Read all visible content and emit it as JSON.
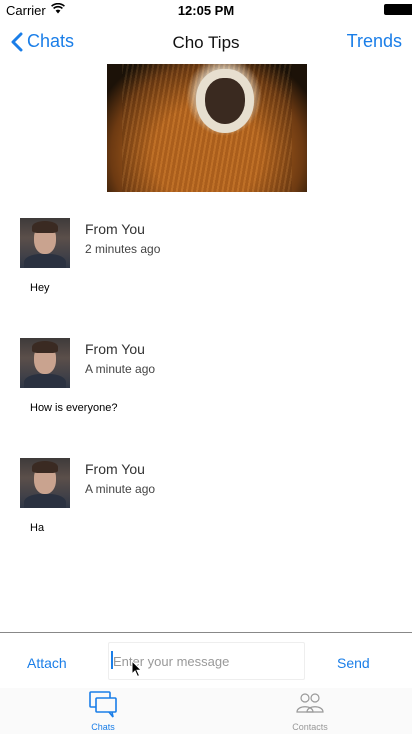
{
  "status_bar": {
    "carrier": "Carrier",
    "time": "12:05 PM",
    "icons": [
      "wifi-icon",
      "battery-icon"
    ]
  },
  "nav": {
    "back_label": "Chats",
    "title": "Cho Tips",
    "right_label": "Trends"
  },
  "messages": [
    {
      "sender": "From You",
      "time": "2 minutes ago",
      "text": "Hey"
    },
    {
      "sender": "From You",
      "time": "A minute ago",
      "text": "How is everyone?"
    },
    {
      "sender": "From You",
      "time": "A minute ago",
      "text": "Ha"
    }
  ],
  "composer": {
    "attach_label": "Attach",
    "input_value": "",
    "input_placeholder": "Enter your message",
    "send_label": "Send"
  },
  "tabs": [
    {
      "label": "Chats",
      "icon": "chat-bubbles-icon",
      "selected": true
    },
    {
      "label": "Contacts",
      "icon": "contacts-icon",
      "selected": false
    }
  ],
  "colors": {
    "accent": "#1a7ee8",
    "inactive_tab": "#999999"
  }
}
